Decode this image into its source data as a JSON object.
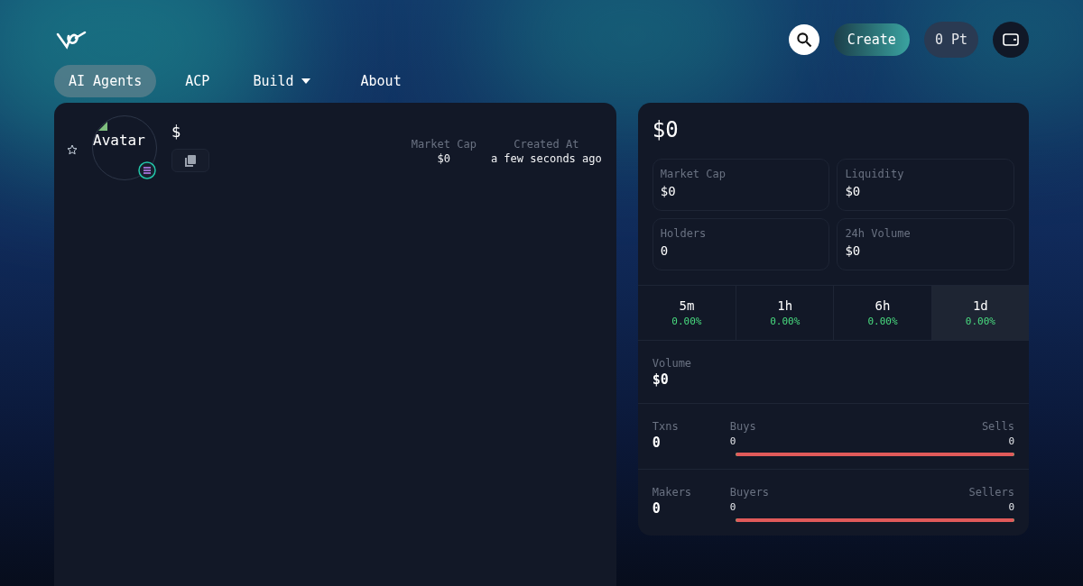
{
  "nav": {
    "tabs": [
      {
        "label": "AI Agents",
        "selected": true,
        "kind": "link"
      },
      {
        "label": "ACP",
        "selected": false,
        "kind": "link"
      },
      {
        "label": "Build",
        "selected": false,
        "kind": "dropdown"
      },
      {
        "label": "About",
        "selected": false,
        "kind": "link"
      }
    ],
    "create": "Create",
    "points": "0 Pt"
  },
  "token": {
    "favorite": false,
    "avatar_alt": "Avatar",
    "symbol": "$",
    "stats": [
      {
        "label": "Market Cap",
        "value": "$0"
      },
      {
        "label": "Created At",
        "value": "a few seconds ago"
      }
    ]
  },
  "summary": {
    "price": "$0",
    "metrics": [
      {
        "label": "Market Cap",
        "value": "$0"
      },
      {
        "label": "Liquidity",
        "value": "$0"
      },
      {
        "label": "Holders",
        "value": "0"
      },
      {
        "label": "24h Volume",
        "value": "$0"
      }
    ],
    "periods": [
      {
        "label": "5m",
        "change": "0.00%",
        "selected": false
      },
      {
        "label": "1h",
        "change": "0.00%",
        "selected": false
      },
      {
        "label": "6h",
        "change": "0.00%",
        "selected": false
      },
      {
        "label": "1d",
        "change": "0.00%",
        "selected": true
      }
    ],
    "volume": {
      "label": "Volume",
      "value": "$0"
    },
    "splits": [
      {
        "label": "Txns",
        "value": "0",
        "left_label": "Buys",
        "left_value": "0",
        "right_label": "Sells",
        "right_value": "0",
        "level": 1
      },
      {
        "label": "Makers",
        "value": "0",
        "left_label": "Buyers",
        "left_value": "0",
        "right_label": "Sellers",
        "right_value": "0",
        "level": 1
      }
    ]
  }
}
